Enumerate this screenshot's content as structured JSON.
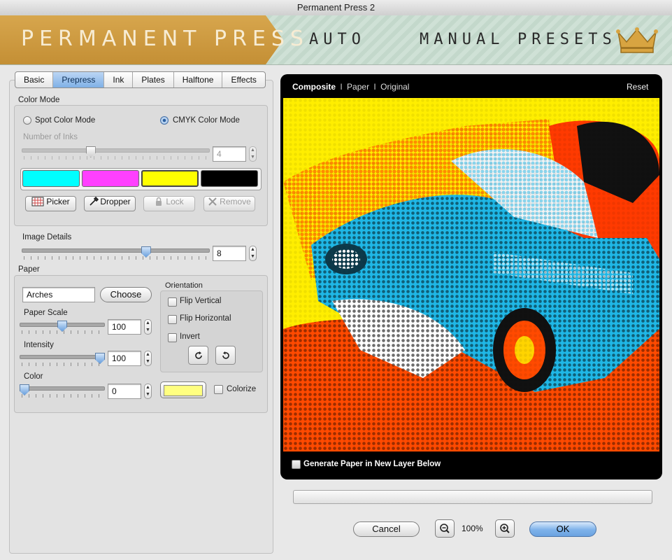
{
  "window": {
    "title": "Permanent Press 2"
  },
  "header": {
    "brand": "PERMANENT PRESS",
    "modes": [
      "AUTO",
      "MANUAL",
      "PRESETS"
    ],
    "crown_icon": "crown-icon"
  },
  "tabs": [
    "Basic",
    "Prepress",
    "Ink",
    "Plates",
    "Halftone",
    "Effects"
  ],
  "active_tab": "Prepress",
  "color_mode": {
    "section_label": "Color Mode",
    "spot_label": "Spot Color Mode",
    "cmyk_label": "CMYK Color Mode",
    "selected": "CMYK Color Mode",
    "inks_label": "Number of Inks",
    "inks_value": "4",
    "inks_fraction": 0.36,
    "swatches": [
      "#00ffff",
      "#ff40ff",
      "#ffff00",
      "#000000"
    ],
    "buttons": {
      "picker": "Picker",
      "dropper": "Dropper",
      "lock": "Lock",
      "remove": "Remove"
    }
  },
  "image_details": {
    "label": "Image Details",
    "value": "8",
    "fraction": 0.67
  },
  "paper": {
    "section_label": "Paper",
    "name_value": "Arches",
    "choose_label": "Choose",
    "scale_label": "Paper Scale",
    "scale_value": "100",
    "scale_fraction": 0.5,
    "intensity_label": "Intensity",
    "intensity_value": "100",
    "intensity_fraction": 1.0,
    "color_label": "Color",
    "color_value": "0",
    "color_fraction": 0.0,
    "paper_color": "#ffff80",
    "colorize_label": "Colorize"
  },
  "orientation": {
    "label": "Orientation",
    "flip_vertical": "Flip Vertical",
    "flip_horizontal": "Flip Horizontal",
    "invert": "Invert"
  },
  "preview": {
    "composite": "Composite",
    "paper": "Paper",
    "original": "Original",
    "separator": "I",
    "reset": "Reset",
    "generate_label": "Generate Paper in New Layer Below"
  },
  "footer": {
    "cancel": "Cancel",
    "zoom": "100%",
    "ok": "OK"
  },
  "colors": {
    "accent": "#6aa2e0",
    "brand_gold": "#c9953a",
    "preview_bg": "#000000"
  }
}
